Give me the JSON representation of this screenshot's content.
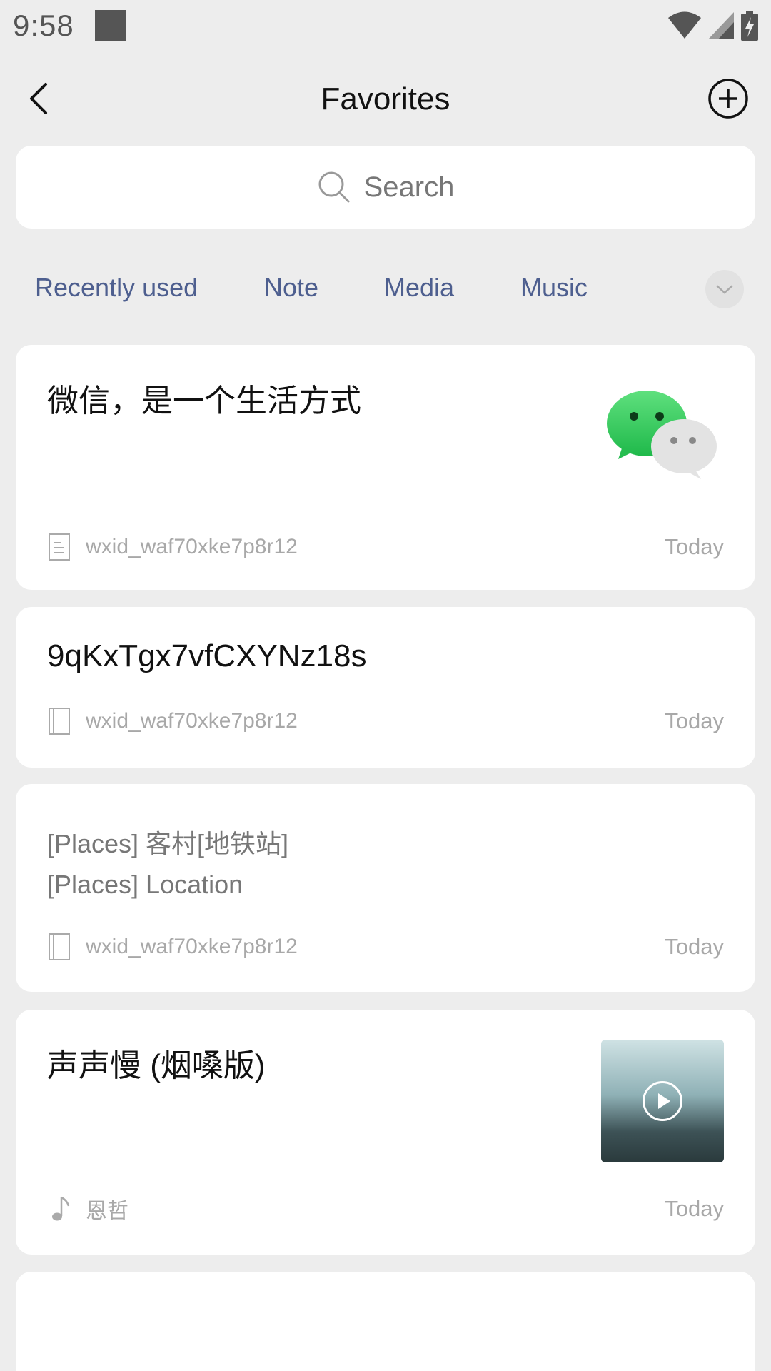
{
  "status_bar": {
    "time": "9:58"
  },
  "nav": {
    "title": "Favorites"
  },
  "search": {
    "placeholder": "Search"
  },
  "tabs": [
    {
      "label": "Recently used"
    },
    {
      "label": "Note"
    },
    {
      "label": "Media"
    },
    {
      "label": "Music"
    }
  ],
  "items": [
    {
      "title": "微信，是一个生活方式",
      "source": "wxid_waf70xke7p8r12",
      "time": "Today",
      "icon": "note-icon",
      "thumb": "wechat-logo"
    },
    {
      "title": "9qKxTgx7vfCXYNz18s",
      "source": "wxid_waf70xke7p8r12",
      "time": "Today",
      "icon": "book-icon"
    },
    {
      "lines": [
        "[Places] 客村[地铁站]",
        "[Places] Location"
      ],
      "source": "wxid_waf70xke7p8r12",
      "time": "Today",
      "icon": "book-icon"
    },
    {
      "title": "声声慢 (烟嗓版)",
      "source": "恩哲",
      "time": "Today",
      "icon": "music-note-icon",
      "thumb": "album-cover"
    }
  ]
}
